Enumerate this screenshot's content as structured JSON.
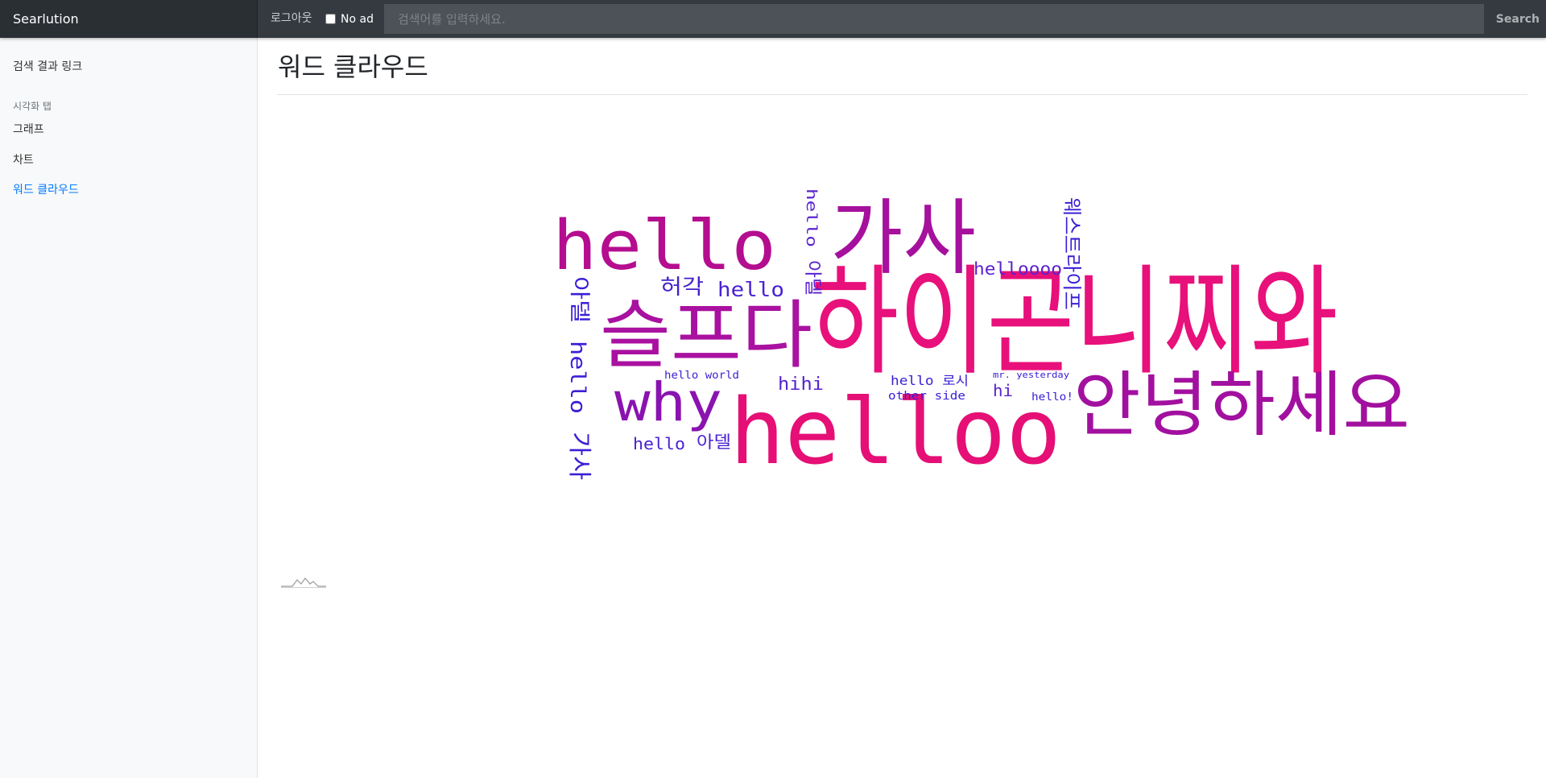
{
  "navbar": {
    "brand": "Searlution",
    "logout": "로그아웃",
    "no_ad_label": "No ad",
    "search_placeholder": "검색어를 입력하세요.",
    "search_button": "Search"
  },
  "sidebar": {
    "link_results": "검색 결과 링크",
    "section_heading": "시각화 탭",
    "items": [
      {
        "label": "그래프",
        "active": false
      },
      {
        "label": "차트",
        "active": false
      },
      {
        "label": "워드 클라우드",
        "active": true
      }
    ]
  },
  "main": {
    "title": "워드 클라우드"
  },
  "colors": {
    "accent": "#007bff",
    "navbar": "#343a40",
    "cloud_pink": "#e8107a",
    "cloud_purple": "#9210a8",
    "cloud_blue": "#2222dd"
  },
  "wordcloud": [
    {
      "word": "하이곤니찌와"
    },
    {
      "word": "helloo"
    },
    {
      "word": "안녕하세요"
    },
    {
      "word": "가사"
    },
    {
      "word": "슬프다"
    },
    {
      "word": "hello"
    },
    {
      "word": "why"
    },
    {
      "word": "허각"
    },
    {
      "word": "hello"
    },
    {
      "word": "helloooo"
    },
    {
      "word": "hello world"
    },
    {
      "word": "hihi"
    },
    {
      "word": "hello 로시"
    },
    {
      "word": "other side"
    },
    {
      "word": "hi"
    },
    {
      "word": "mr. yesterday"
    },
    {
      "word": "hello!"
    },
    {
      "word": "hello"
    },
    {
      "word": "아델"
    },
    {
      "word": "아델"
    },
    {
      "word": "hello"
    },
    {
      "word": "가사"
    },
    {
      "word": "hello"
    },
    {
      "word": "아델"
    },
    {
      "word": "웨스트라이프"
    }
  ]
}
